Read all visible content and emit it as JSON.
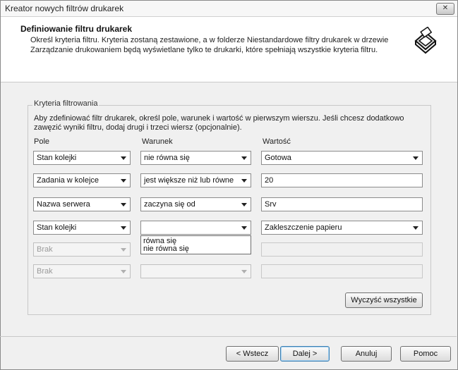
{
  "window": {
    "title": "Kreator nowych filtrów drukarek",
    "close_label": "✕"
  },
  "header": {
    "title": "Definiowanie filtru drukarek",
    "description": "Określ kryteria filtru. Kryteria zostaną zestawione, a w folderze Niestandardowe filtry drukarek w drzewie Zarządzanie drukowaniem będą wyświetlane tylko te drukarki, które spełniają wszystkie kryteria filtru.",
    "icon": "printer-icon"
  },
  "group": {
    "label": "Kryteria filtrowania",
    "instructions": "Aby zdefiniować filtr drukarek, określ pole, warunek i wartość w pierwszym wierszu. Jeśli chcesz dodatkowo zawęzić wyniki filtru, dodaj drugi i trzeci wiersz (opcjonalnie).",
    "headers": {
      "field": "Pole",
      "condition": "Warunek",
      "value": "Wartość"
    },
    "rows": [
      {
        "field": "Stan kolejki",
        "condition": "nie równa się",
        "value": "Gotowa"
      },
      {
        "field": "Zadania w kolejce",
        "condition": "jest większe niż lub równe",
        "value": "20"
      },
      {
        "field": "Nazwa serwera",
        "condition": "zaczyna się od",
        "value": "Srv"
      },
      {
        "field": "Stan kolejki",
        "condition": "",
        "value": "Zakleszczenie papieru"
      },
      {
        "field": "Brak",
        "condition": "",
        "value": ""
      },
      {
        "field": "Brak",
        "condition": "",
        "value": ""
      }
    ],
    "dropdown_options": [
      "równa się",
      "nie równa się"
    ],
    "clear_all": "Wyczyść wszystkie"
  },
  "footer": {
    "back": "< Wstecz",
    "next": "Dalej >",
    "cancel": "Anuluj",
    "help": "Pomoc"
  }
}
